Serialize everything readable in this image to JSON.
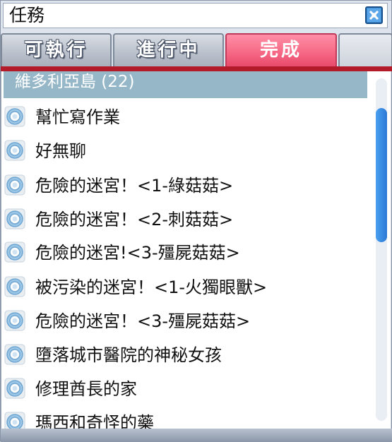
{
  "window": {
    "title": "任務"
  },
  "tabs": [
    {
      "label": "可執行"
    },
    {
      "label": "進行中"
    },
    {
      "label": "完成",
      "active": true
    }
  ],
  "colors": {
    "active_tab": "#f56683",
    "divider": "#b31b2b",
    "group_header": "#96b7c8",
    "scroll_thumb": "#2b79d6"
  },
  "list": {
    "group_header": "維多利亞島 (22)",
    "items": [
      {
        "label": "幫忙寫作業",
        "icon": "quest-complete-icon"
      },
      {
        "label": "好無聊",
        "icon": "quest-complete-icon"
      },
      {
        "label": "危險的迷宮！<1-綠菇菇>",
        "icon": "quest-complete-icon"
      },
      {
        "label": "危險的迷宮！<2-刺菇菇>",
        "icon": "quest-complete-icon"
      },
      {
        "label": "危險的迷宮!<3-殭屍菇菇>",
        "icon": "quest-complete-icon"
      },
      {
        "label": "被污染的迷宮！<1-火獨眼獸>",
        "icon": "quest-complete-icon"
      },
      {
        "label": "危險的迷宮！<3-殭屍菇菇>",
        "icon": "quest-complete-icon"
      },
      {
        "label": "墮落城市醫院的神秘女孩",
        "icon": "quest-complete-icon"
      },
      {
        "label": "修理酋長的家",
        "icon": "quest-complete-icon"
      },
      {
        "label": "瑪西和奇怪的藥",
        "icon": "quest-complete-icon"
      }
    ]
  }
}
